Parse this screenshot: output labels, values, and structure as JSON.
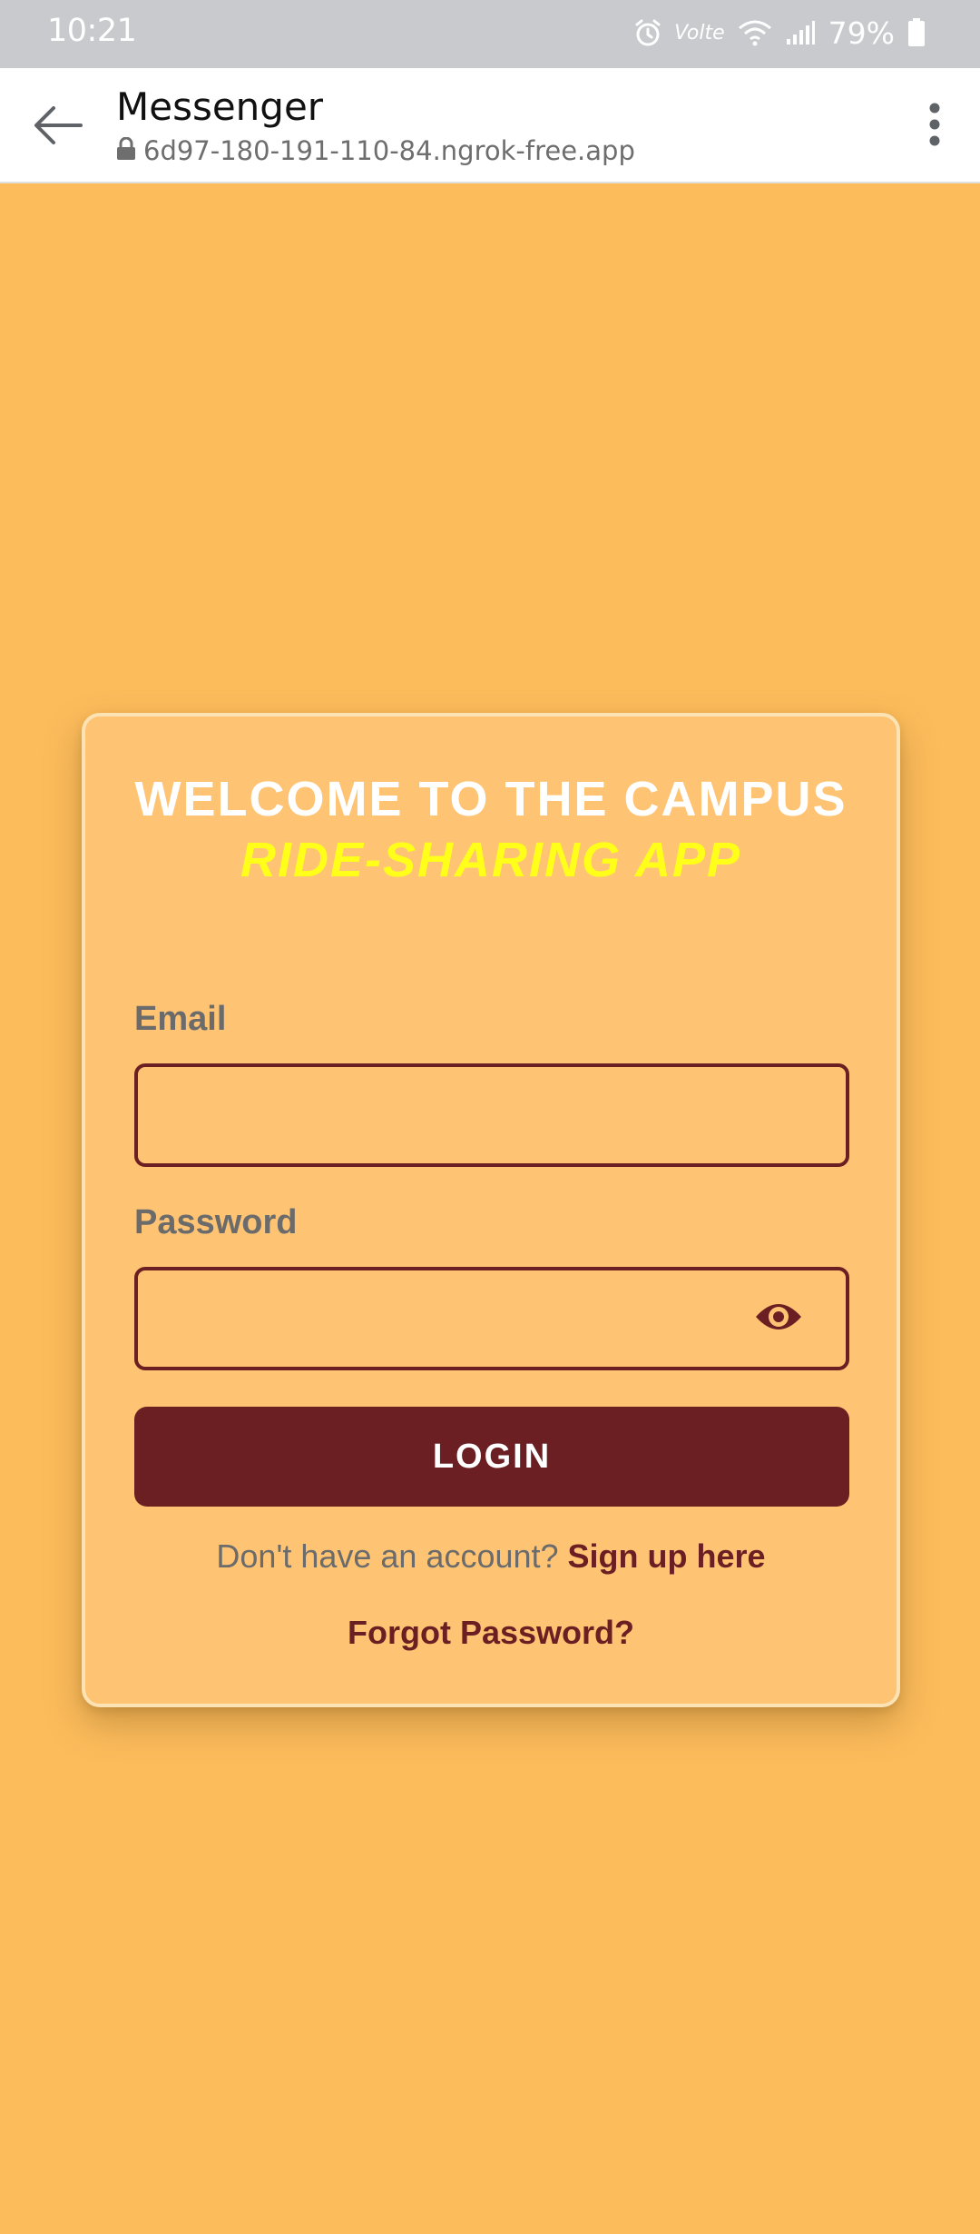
{
  "status_bar": {
    "time": "10:21",
    "network_label": "Volte",
    "battery_percent": "79%",
    "icons": [
      "alarm-icon",
      "wifi-icon",
      "signal-icon",
      "battery-icon"
    ]
  },
  "browser_header": {
    "title": "Messenger",
    "url": "6d97-180-191-110-84.ngrok-free.app",
    "icons": [
      "back-arrow-icon",
      "lock-icon",
      "more-vertical-icon"
    ]
  },
  "login": {
    "title_part1": "WELCOME TO THE CAMPUS ",
    "title_accent": "RIDE-SHARING APP",
    "email_label": "Email",
    "email_value": "",
    "password_label": "Password",
    "password_value": "",
    "login_button": "LOGIN",
    "signup_prompt": "Don't have an account? ",
    "signup_link": "Sign up here",
    "forgot_link": "Forgot Password?",
    "icons": [
      "eye-icon"
    ]
  },
  "colors": {
    "page_background": "#fcbc5c",
    "card_background": "#fec474",
    "primary": "#6b1f22",
    "title_accent": "#ffff1a",
    "muted_text": "#6b6b6b"
  }
}
